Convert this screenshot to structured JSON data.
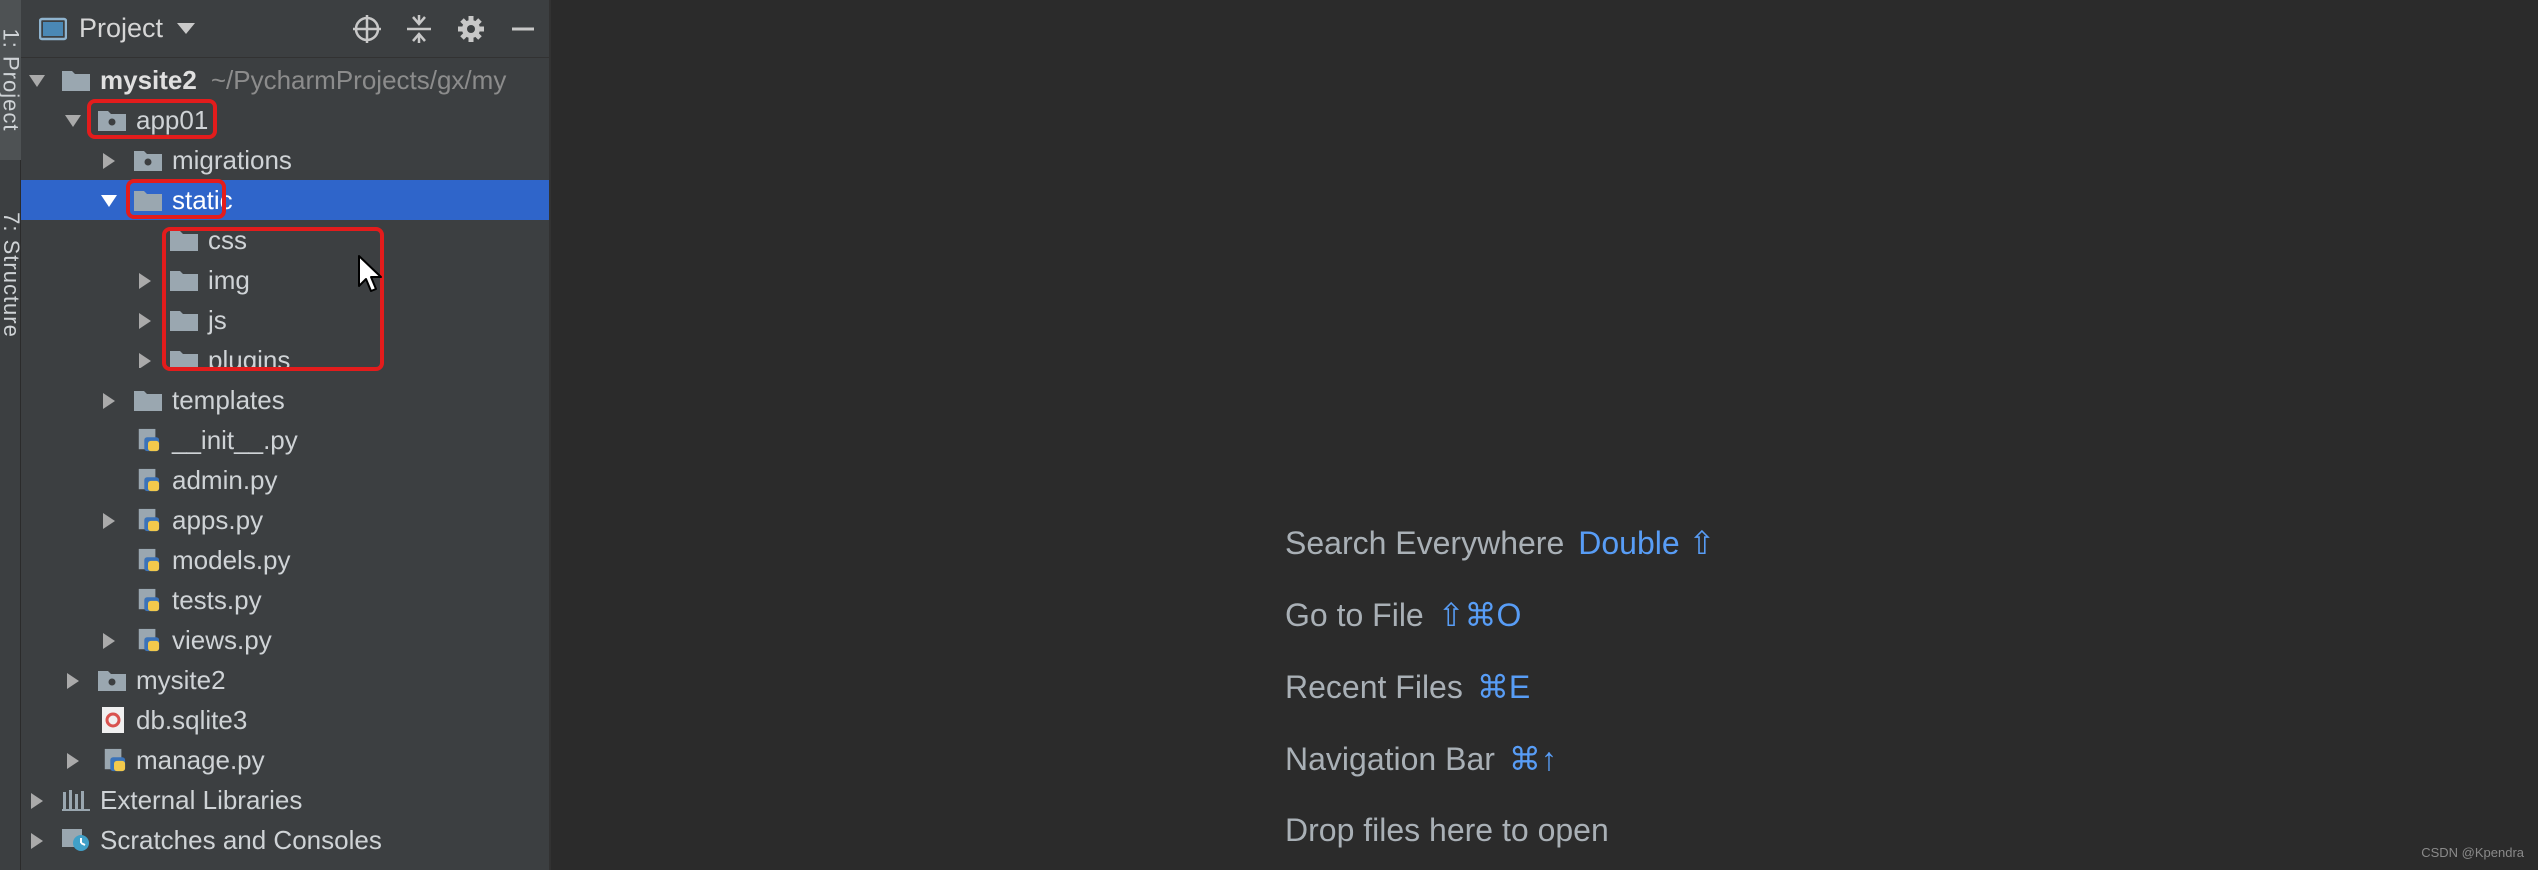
{
  "left_strip": {
    "tab_project": "1: Project",
    "tab_structure": "7: Structure"
  },
  "panel": {
    "title": "Project",
    "tools": [
      "locate-icon",
      "collapse-all-icon",
      "gear-icon",
      "minimize-icon"
    ]
  },
  "tree": {
    "root_name": "mysite2",
    "root_path": "~/PycharmProjects/gx/my",
    "items": [
      {
        "label": "app01"
      },
      {
        "label": "migrations"
      },
      {
        "label": "static"
      },
      {
        "label": "css"
      },
      {
        "label": "img"
      },
      {
        "label": "js"
      },
      {
        "label": "plugins"
      },
      {
        "label": "templates"
      },
      {
        "label": "__init__.py"
      },
      {
        "label": "admin.py"
      },
      {
        "label": "apps.py"
      },
      {
        "label": "models.py"
      },
      {
        "label": "tests.py"
      },
      {
        "label": "views.py"
      },
      {
        "label": "mysite2"
      },
      {
        "label": "db.sqlite3"
      },
      {
        "label": "manage.py"
      },
      {
        "label": "External Libraries"
      },
      {
        "label": "Scratches and Consoles"
      }
    ]
  },
  "editor": {
    "hints": [
      {
        "label": "Search Everywhere",
        "keys": "Double ⇧"
      },
      {
        "label": "Go to File",
        "keys": "⇧⌘O"
      },
      {
        "label": "Recent Files",
        "keys": "⌘E"
      },
      {
        "label": "Navigation Bar",
        "keys": "⌘↑"
      },
      {
        "label": "Drop files here to open",
        "keys": ""
      }
    ],
    "watermark": "CSDN @Kpendra"
  },
  "colors": {
    "selection": "#2f65ca",
    "highlight": "#e31c1c",
    "shortcut": "#589df6"
  }
}
